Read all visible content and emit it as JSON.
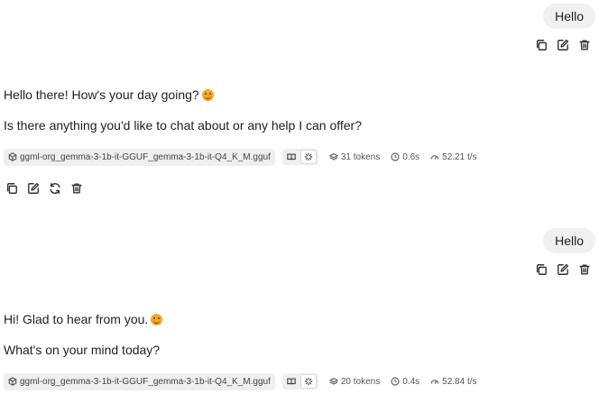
{
  "messages": [
    {
      "role": "user",
      "text": "Hello"
    },
    {
      "role": "assistant",
      "paragraphs": [
        "Hello there! How's your day going?",
        "Is there anything you'd like to chat about or any help I can offer?"
      ],
      "model": "ggml-org_gemma-3-1b-it-GGUF_gemma-3-1b-it-Q4_K_M.gguf",
      "tokens": "31 tokens",
      "time": "0.6s",
      "speed": "52.21 t/s"
    },
    {
      "role": "user",
      "text": "Hello"
    },
    {
      "role": "assistant",
      "paragraphs": [
        "Hi! Glad to hear from you.",
        "What's on your mind today?"
      ],
      "model": "ggml-org_gemma-3-1b-it-GGUF_gemma-3-1b-it-Q4_K_M.gguf",
      "tokens": "20 tokens",
      "time": "0.4s",
      "speed": "52.84 t/s"
    }
  ],
  "icons": {
    "copy": "copy-icon",
    "edit": "edit-icon",
    "delete": "trash-icon",
    "regenerate": "refresh-icon",
    "model": "package-icon",
    "reading_mode": "book-icon",
    "stats_mode": "sparkle-icon",
    "tokens": "layers-icon",
    "time": "clock-icon",
    "speed": "gauge-icon"
  },
  "emoji": "😊"
}
